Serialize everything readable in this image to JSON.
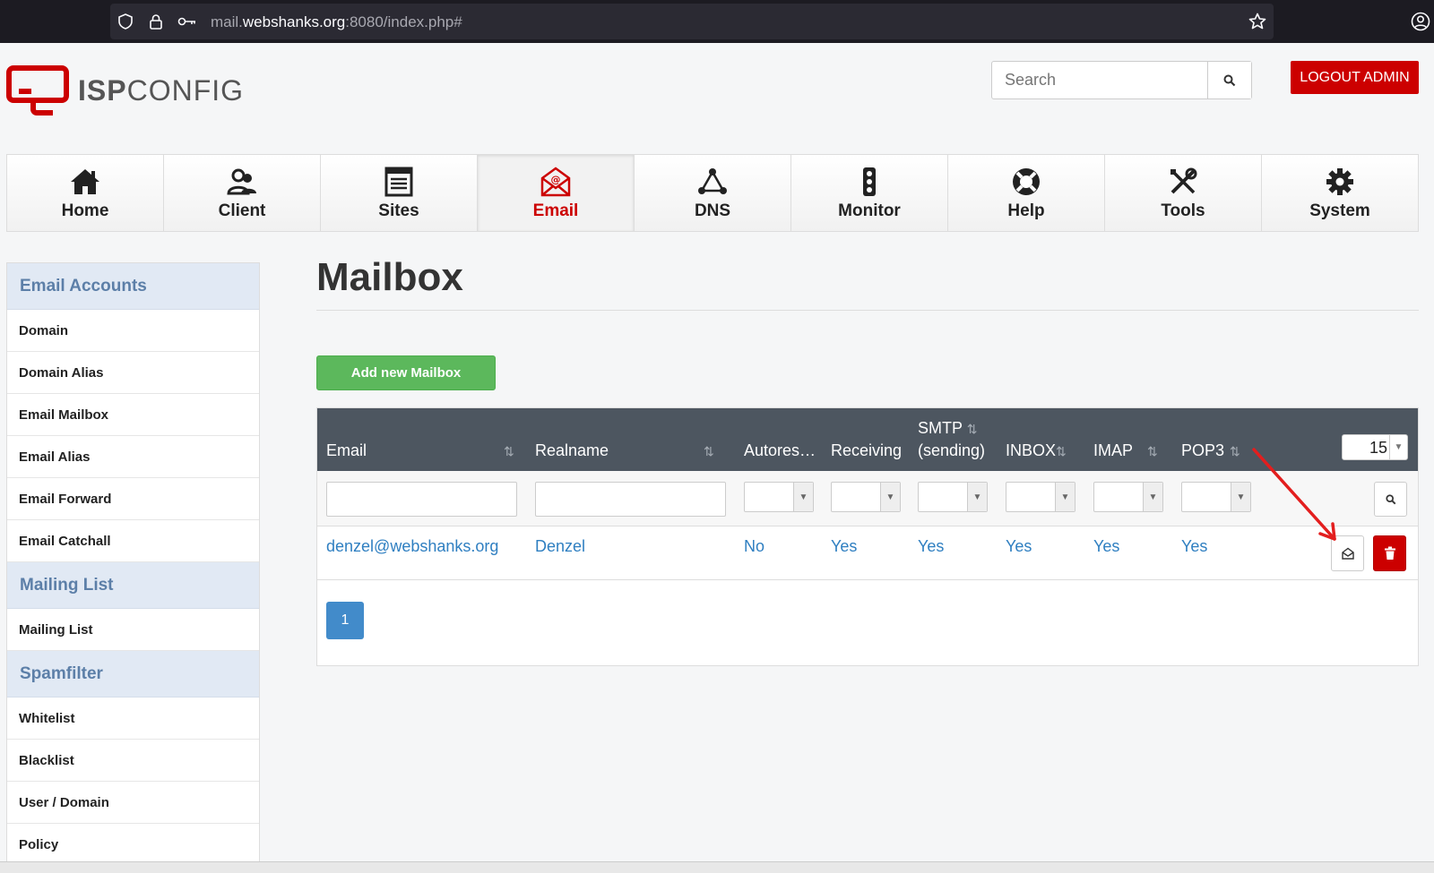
{
  "browser": {
    "url_prefix": "mail.",
    "url_domain": "webshanks.org",
    "url_suffix": ":8080/index.php#"
  },
  "header": {
    "logo_bold": "ISP",
    "logo_light": "CONFIG",
    "search_placeholder": "Search",
    "logout_label": "LOGOUT ADMIN"
  },
  "nav": {
    "items": [
      {
        "label": "Home",
        "icon": "home-icon"
      },
      {
        "label": "Client",
        "icon": "client-icon"
      },
      {
        "label": "Sites",
        "icon": "sites-icon"
      },
      {
        "label": "Email",
        "icon": "email-icon",
        "active": true
      },
      {
        "label": "DNS",
        "icon": "dns-icon"
      },
      {
        "label": "Monitor",
        "icon": "monitor-icon"
      },
      {
        "label": "Help",
        "icon": "help-icon"
      },
      {
        "label": "Tools",
        "icon": "tools-icon"
      },
      {
        "label": "System",
        "icon": "gear-icon"
      }
    ]
  },
  "sidebar": {
    "section1": "Email Accounts",
    "items1": [
      "Domain",
      "Domain Alias",
      "Email Mailbox",
      "Email Alias",
      "Email Forward",
      "Email Catchall"
    ],
    "section2": "Mailing List",
    "items2": [
      "Mailing List"
    ],
    "section3": "Spamfilter",
    "items3": [
      "Whitelist",
      "Blacklist",
      "User / Domain",
      "Policy"
    ]
  },
  "main": {
    "title": "Mailbox",
    "add_button": "Add new Mailbox",
    "per_page": "15",
    "columns": {
      "email": "Email",
      "realname": "Realname",
      "autoresponder": "Autores…",
      "receiving": "Receiving",
      "smtp_line1": "SMTP",
      "smtp_line2": "(sending)",
      "inbox": "INBOX",
      "imap": "IMAP",
      "pop3": "POP3"
    },
    "rows": [
      {
        "email": "denzel@webshanks.org",
        "realname": "Denzel",
        "autoresponder": "No",
        "receiving": "Yes",
        "smtp": "Yes",
        "inbox": "Yes",
        "imap": "Yes",
        "pop3": "Yes"
      }
    ],
    "page": "1"
  },
  "colors": {
    "accent_red": "#cc0000",
    "table_header": "#4d5660",
    "link_blue": "#2f7fc1",
    "green_button": "#5cb85c"
  }
}
